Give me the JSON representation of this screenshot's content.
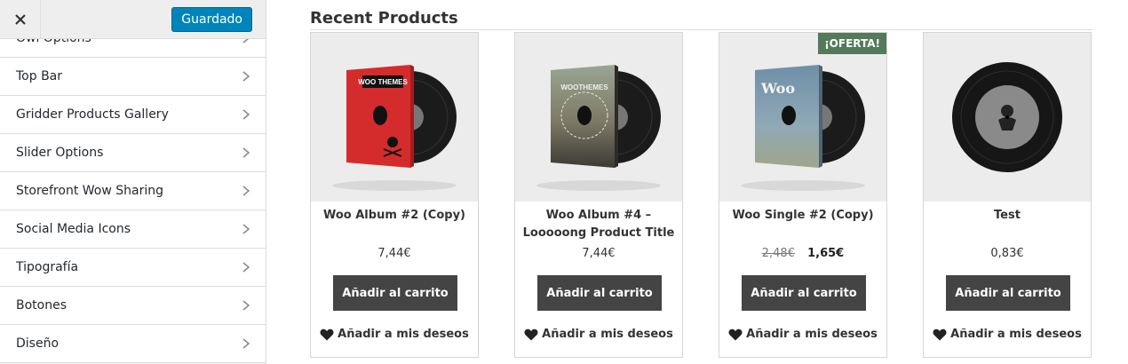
{
  "sidebar": {
    "close_icon": "close-icon",
    "save_label": "Guardado",
    "items": [
      {
        "label": "Owl Options"
      },
      {
        "label": "Top Bar"
      },
      {
        "label": "Gridder Products Gallery"
      },
      {
        "label": "Slider Options"
      },
      {
        "label": "Storefront Wow Sharing"
      },
      {
        "label": "Social Media Icons"
      },
      {
        "label": "Tipografía"
      },
      {
        "label": "Botones"
      },
      {
        "label": "Diseño"
      }
    ]
  },
  "main": {
    "section_title": "Recent Products",
    "products": [
      {
        "name": "Woo Album #2 (Copy)",
        "price": "7,44€",
        "old_price": "",
        "sale": false,
        "cover": "red",
        "cover_text": "WOO THEMES",
        "button": "Añadir al carrito",
        "wishlist": "Añadir a mis deseos"
      },
      {
        "name": "Woo Album #4 – Looooong Product Title",
        "price": "7,44€",
        "old_price": "",
        "sale": false,
        "cover": "city",
        "cover_text": "WOOTHEMES",
        "button": "Añadir al carrito",
        "wishlist": "Añadir a mis deseos"
      },
      {
        "name": "Woo Single #2 (Copy)",
        "price": "1,65€",
        "old_price": "2,48€",
        "sale": true,
        "badge": "¡OFERTA!",
        "cover": "sky",
        "cover_text": "Woo",
        "button": "Añadir al carrito",
        "wishlist": "Añadir a mis deseos"
      },
      {
        "name": "Test",
        "price": "0,83€",
        "old_price": "",
        "sale": false,
        "cover": "vinyl",
        "cover_text": "",
        "button": "Añadir al carrito",
        "wishlist": "Añadir a mis deseos"
      }
    ]
  },
  "colors": {
    "save_button": "#0085ba",
    "cart_button": "#444444",
    "sale_badge": "#547a5a"
  }
}
